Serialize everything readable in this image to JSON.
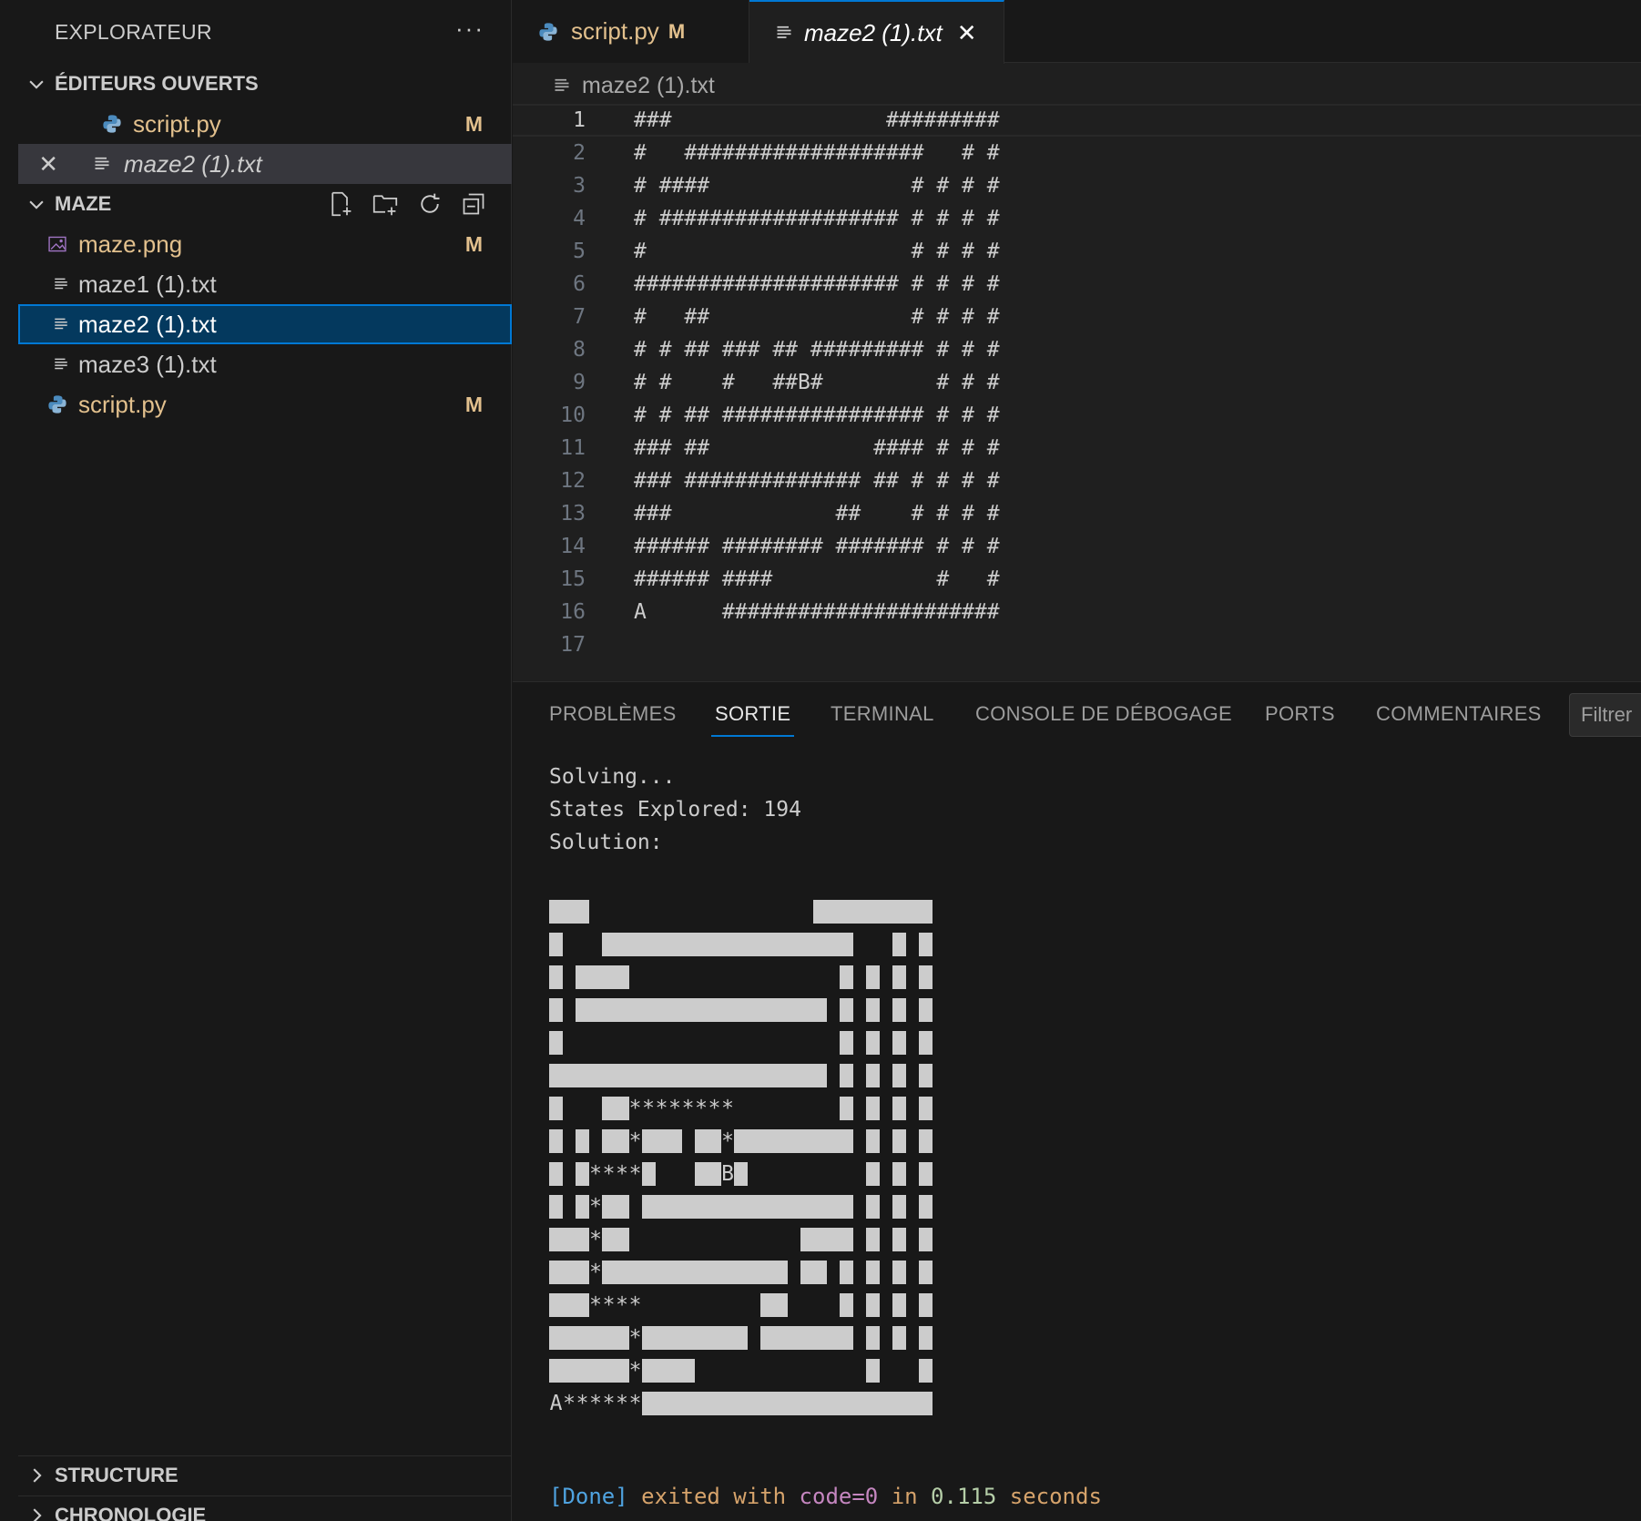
{
  "sidebar": {
    "title": "EXPLORATEUR",
    "more": "···",
    "open_editors": {
      "label": "ÉDITEURS OUVERTS",
      "items": [
        {
          "name": "script.py",
          "badge": "M"
        },
        {
          "name": "maze2 (1).txt",
          "close": "✕"
        }
      ]
    },
    "folder": {
      "label": "MAZE",
      "items": [
        {
          "name": "maze.png",
          "badge": "M"
        },
        {
          "name": "maze1 (1).txt"
        },
        {
          "name": "maze2 (1).txt"
        },
        {
          "name": "maze3 (1).txt"
        },
        {
          "name": "script.py",
          "badge": "M"
        }
      ]
    },
    "structure": "STRUCTURE",
    "timeline": "CHRONOLOGIE"
  },
  "tabs": [
    {
      "label": "script.py",
      "badge": "M"
    },
    {
      "label": "maze2 (1).txt",
      "close": "✕"
    }
  ],
  "breadcrumb": "maze2 (1).txt",
  "code_lines": [
    "###                 #########",
    "#   ###################   # #",
    "# ####                # # # #",
    "# ################### # # # #",
    "#                     # # # #",
    "##################### # # # #",
    "#   ##                # # # #",
    "# # ## ### ## ######### # # #",
    "# #    #   ##B#         # # #",
    "# # ## ################ # # #",
    "### ##             #### # # #",
    "### ############## ## # # # #",
    "###             ##    # # # #",
    "###### ######## ####### # # #",
    "###### ####             #   #",
    "A      ######################",
    ""
  ],
  "panel": {
    "tabs": [
      "PROBLÈMES",
      "SORTIE",
      "TERMINAL",
      "CONSOLE DE DÉBOGAGE",
      "PORTS",
      "COMMENTAIRES"
    ],
    "filter_placeholder": "Filtrer",
    "output_lines": [
      "Solving...",
      "States Explored: 194",
      "Solution:"
    ],
    "solution_rows": [
      "###                 #########",
      "#   ###################   # #",
      "# ####                # # # #",
      "# ################### # # # #",
      "#                     # # # #",
      "##################### # # # #",
      "#   ##********        # # # #",
      "# # ##*### ##*######### # # #",
      "# #****#   ##B#         # # #",
      "# #*## ################ # # #",
      "###*##             #### # # #",
      "###*############## ## # # # #",
      "###****         ##    # # # #",
      "######*######## ####### # # #",
      "######*####             #   #",
      "A******######################"
    ],
    "done": {
      "tag": "[Done]",
      "text1": " exited with ",
      "code": "code=0",
      "text2": " in ",
      "time": "0.115",
      "text3": " seconds"
    }
  },
  "colors": {
    "accent": "#0078d4",
    "modified": "#e2c08d",
    "python": "#4b8bbe",
    "image": "#a074c4"
  }
}
